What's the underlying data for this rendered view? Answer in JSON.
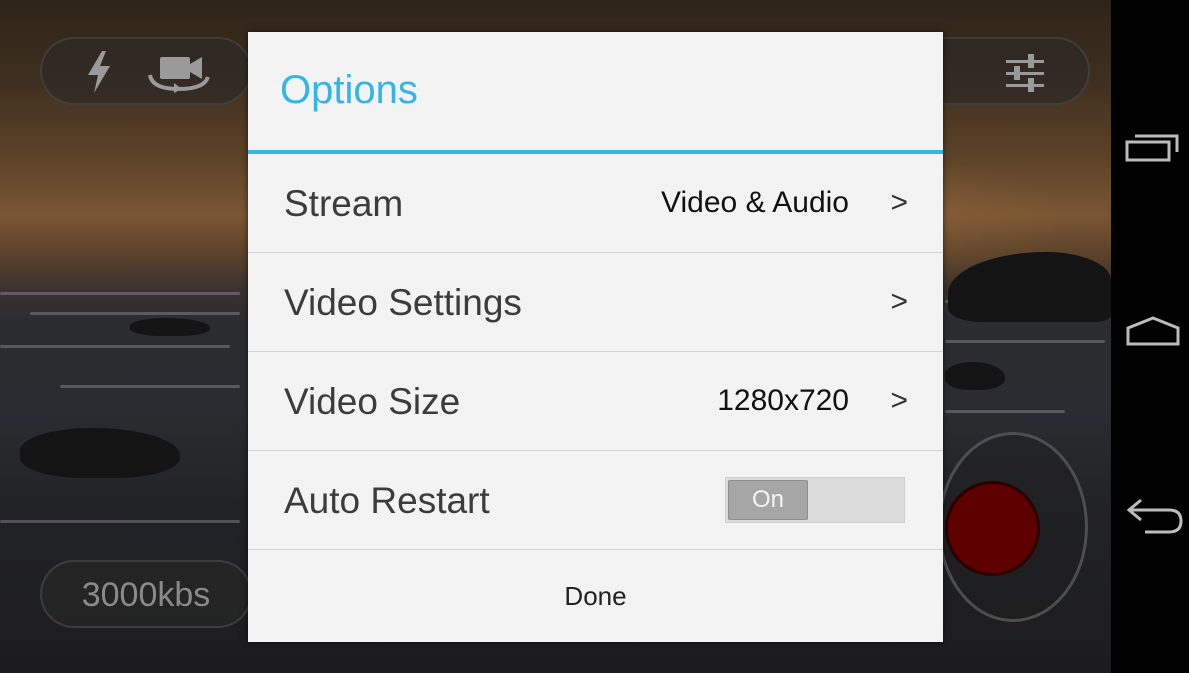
{
  "overlay": {
    "bitrate_text": "3000kbs"
  },
  "dialog": {
    "title": "Options",
    "rows": [
      {
        "label": "Stream",
        "value": "Video & Audio",
        "chevron": ">"
      },
      {
        "label": "Video Settings",
        "value": "",
        "chevron": ">"
      },
      {
        "label": "Video Size",
        "value": "1280x720",
        "chevron": ">"
      },
      {
        "label": "Auto Restart",
        "toggle_state": "On"
      }
    ],
    "done_label": "Done"
  },
  "colors": {
    "accent": "#33b5e5",
    "record": "#5e0000"
  }
}
